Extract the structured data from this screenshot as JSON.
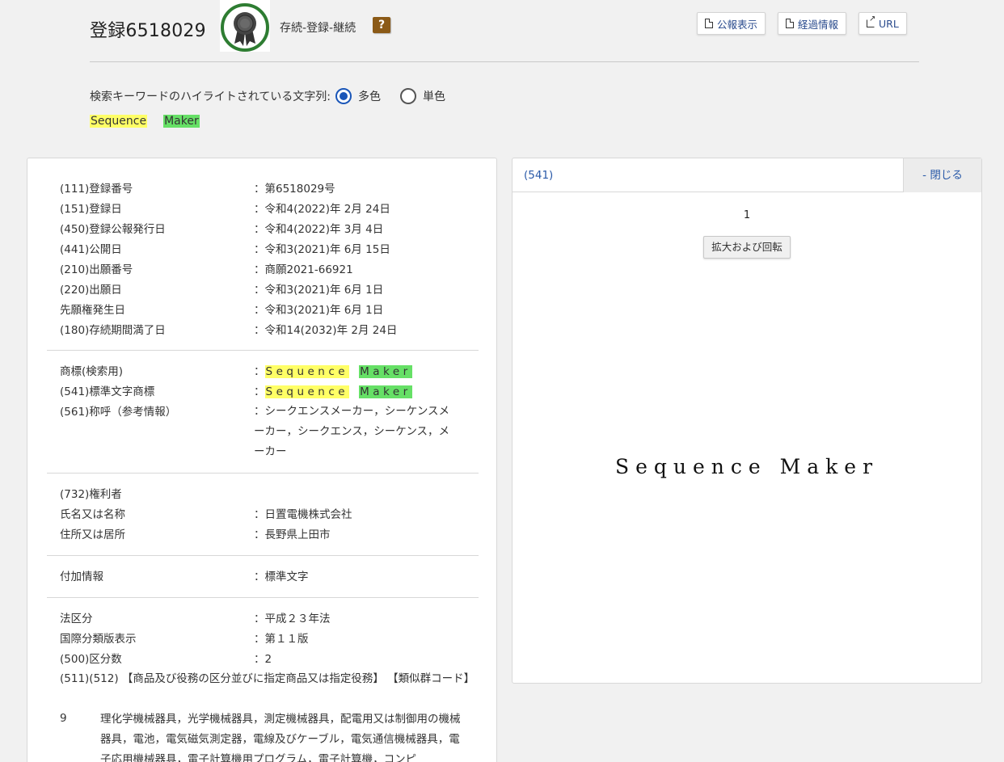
{
  "header": {
    "title": "登録6518029",
    "status": "存続-登録-継続",
    "help": "?",
    "buttons": {
      "gazette": "公報表示",
      "progress": "経過情報",
      "url": "URL"
    }
  },
  "highlight": {
    "label": "検索キーワードのハイライトされている文字列:",
    "options": [
      "多色",
      "単色"
    ],
    "selected": "多色",
    "keywords": [
      "Sequence",
      "Maker"
    ]
  },
  "details": {
    "basic": [
      {
        "label": "(111)登録番号",
        "value": "：第6518029号"
      },
      {
        "label": "(151)登録日",
        "value": "：令和4(2022)年 2月 24日"
      },
      {
        "label": "(450)登録公報発行日",
        "value": "：令和4(2022)年 3月 4日"
      },
      {
        "label": "(441)公開日",
        "value": "：令和3(2021)年 6月 15日"
      },
      {
        "label": "(210)出願番号",
        "value": "：商願2021-66921"
      },
      {
        "label": "(220)出願日",
        "value": "：令和3(2021)年 6月 1日"
      },
      {
        "label": "先願権発生日",
        "value": "：令和3(2021)年 6月 1日"
      },
      {
        "label": "(180)存続期間満了日",
        "value": "：令和14(2032)年 2月 24日"
      }
    ],
    "mark": {
      "search_label": "商標(検索用)",
      "standard_label": "(541)標準文字商標",
      "colon": "：",
      "word1": "Sequence",
      "word2": "Maker",
      "reading_label": "(561)称呼（参考情報）",
      "reading_value": "：シークエンスメーカー，シーケンスメーカー，シークエンス，シーケンス，メーカー"
    },
    "holder": {
      "heading": "(732)権利者",
      "name_label": "氏名又は名称",
      "name_value": "：日置電機株式会社",
      "address_label": "住所又は居所",
      "address_value": "：長野県上田市"
    },
    "additional": {
      "label": "付加情報",
      "value": "：標準文字"
    },
    "law": [
      {
        "label": "法区分",
        "value": "：平成２３年法"
      },
      {
        "label": "国際分類版表示",
        "value": "：第１１版"
      },
      {
        "label": "(500)区分数",
        "value": "：2"
      }
    ],
    "goods_heading": "(511)(512) 【商品及び役務の区分並びに指定商品又は指定役務】 【類似群コード】",
    "goods": {
      "class": "9",
      "text": "理化学機械器具，光学機械器具，測定機械器具，配電用又は制御用の機械器具，電池，電気磁気測定器，電線及びケーブル，電気通信機械器具，電子応用機械器具，電子計算機用プログラム，電子計算機，コンピ"
    }
  },
  "image_panel": {
    "title": "(541)",
    "close": "- 閉じる",
    "page": "1",
    "zoom_button": "拡大および回転",
    "mark_text": "Sequence Maker"
  },
  "colors": {
    "link": "#2a5aa8",
    "radio_selected": "#1a56b8",
    "highlight_yellow": "#ffff66",
    "highlight_green": "#66e066",
    "help_bg": "#8b5a17",
    "medal_ring": "#2e7d32"
  }
}
